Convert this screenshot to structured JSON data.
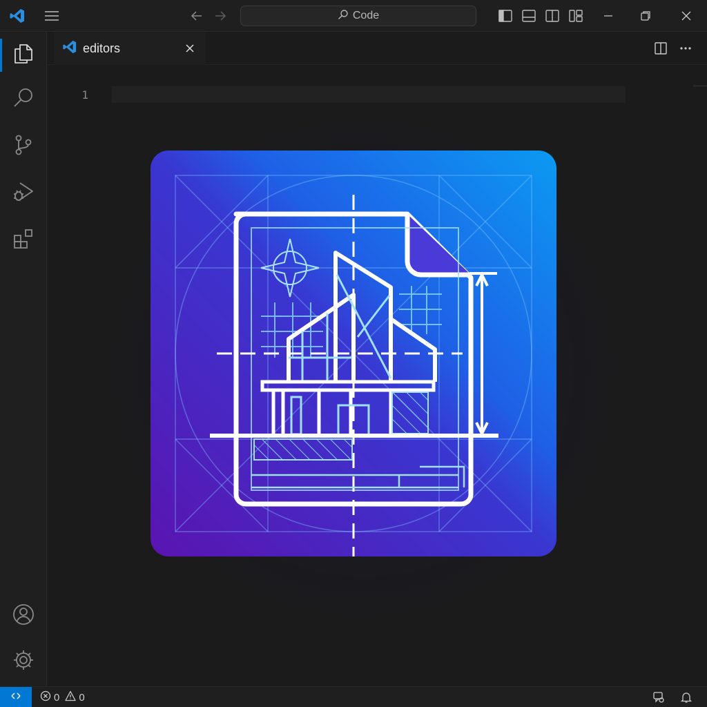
{
  "titlebar": {
    "app_icon": "vscode-logo-icon",
    "menu_icon": "hamburger-menu-icon",
    "back_icon": "arrow-left-icon",
    "forward_icon": "arrow-right-icon",
    "search_icon": "search-icon",
    "command_center_label": "Code",
    "layout_icons": [
      "toggle-primary-sidebar-icon",
      "toggle-panel-icon",
      "toggle-secondary-sidebar-icon",
      "customize-layout-icon"
    ],
    "window_controls": [
      "minimize-icon",
      "restore-icon",
      "close-icon"
    ]
  },
  "activitybar": {
    "items": [
      {
        "name": "explorer",
        "icon": "files-icon",
        "active": true
      },
      {
        "name": "search",
        "icon": "search-icon"
      },
      {
        "name": "source-control",
        "icon": "source-control-icon"
      },
      {
        "name": "run-and-debug",
        "icon": "run-debug-icon"
      },
      {
        "name": "extensions",
        "icon": "extensions-icon"
      }
    ],
    "bottom": [
      {
        "name": "accounts",
        "icon": "account-icon"
      },
      {
        "name": "manage",
        "icon": "gear-icon"
      }
    ]
  },
  "tabs": [
    {
      "label": "editors",
      "icon": "vscode-logo-icon",
      "close_icon": "close-icon"
    }
  ],
  "editor_actions": [
    "split-editor-icon",
    "more-actions-icon"
  ],
  "editor": {
    "line_numbers": [
      "1"
    ],
    "image_icon": "blueprint-building-document-icon"
  },
  "statusbar": {
    "remote_icon": "remote-icon",
    "errors": "0",
    "warnings": "0",
    "right_icons": [
      "copilot-chat-icon",
      "bell-icon"
    ]
  },
  "colors": {
    "accent": "#0078d4",
    "background": "#1b1b1c",
    "chrome": "#1f1f1f",
    "art_purple": "#5a1ab8",
    "art_blue": "#0b8ff0"
  }
}
